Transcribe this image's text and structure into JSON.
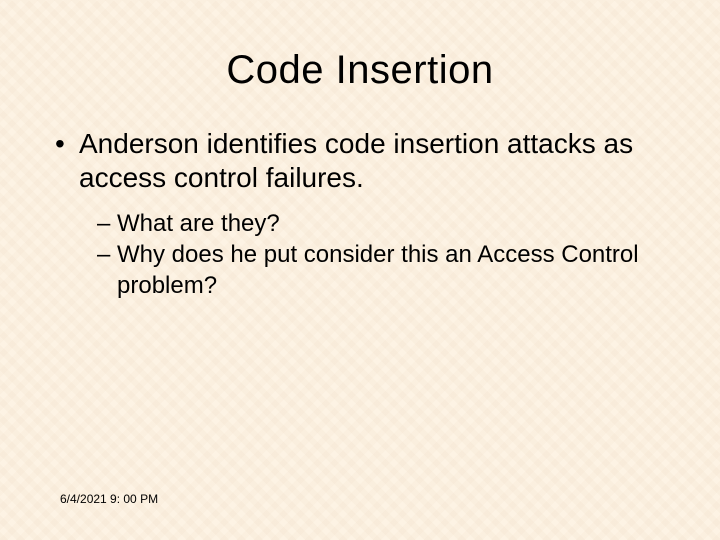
{
  "slide": {
    "title": "Code Insertion",
    "bullet": {
      "marker": "•",
      "text": "Anderson identifies code insertion attacks as access control failures."
    },
    "sub_items": [
      {
        "marker": "–",
        "text": "What are they?"
      },
      {
        "marker": "–",
        "text": "Why does he put consider this an Access Control problem?"
      }
    ],
    "footer": "6/4/2021 9: 00 PM"
  }
}
